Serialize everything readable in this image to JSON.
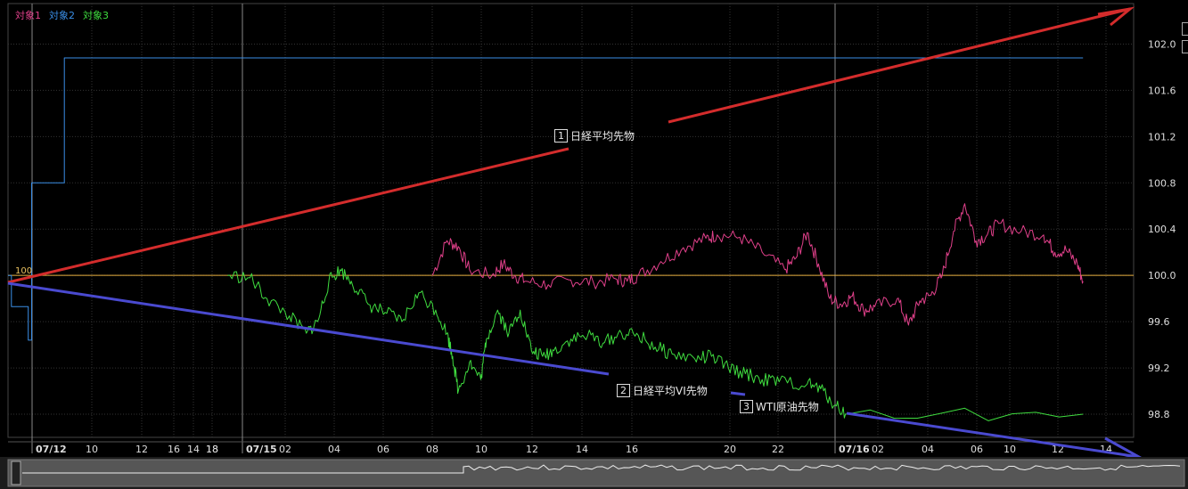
{
  "legend": [
    {
      "label": "対象1",
      "color": "#e0408a"
    },
    {
      "label": "対象2",
      "color": "#3a8ee6"
    },
    {
      "label": "対象3",
      "color": "#3fdc3f"
    }
  ],
  "baseline_label": "100",
  "annotations": [
    {
      "num": "1",
      "text": "日経平均先物"
    },
    {
      "num": "2",
      "text": "日経平均VI先物"
    },
    {
      "num": "3",
      "text": "WTI原油先物"
    }
  ],
  "chart_data": {
    "type": "line",
    "ylim": [
      98.6,
      102.35
    ],
    "y_ticks": [
      "98.8",
      "99.2",
      "99.6",
      "100.0",
      "100.4",
      "100.8",
      "101.2",
      "101.6",
      "102.0"
    ],
    "x_ticks": [
      "07/12",
      "10",
      "12",
      "14",
      "16",
      "18",
      "07/15",
      "02",
      "04",
      "06",
      "08",
      "10",
      "12",
      "14",
      "16",
      "18",
      "20",
      "22",
      "07/16",
      "02",
      "04",
      "06",
      "10",
      "12",
      "14"
    ],
    "baseline": 100,
    "grid": true,
    "series": [
      {
        "name": "対象1",
        "color": "#e0408a",
        "points": [
          [
            0.377,
            100.0
          ],
          [
            0.39,
            100.3
          ],
          [
            0.4,
            100.25
          ],
          [
            0.41,
            100.05
          ],
          [
            0.43,
            100.0
          ],
          [
            0.44,
            100.1
          ],
          [
            0.45,
            100.0
          ],
          [
            0.46,
            99.95
          ],
          [
            0.48,
            99.92
          ],
          [
            0.5,
            99.96
          ],
          [
            0.52,
            99.94
          ],
          [
            0.54,
            99.97
          ],
          [
            0.55,
            99.95
          ],
          [
            0.56,
            100.0
          ],
          [
            0.58,
            100.12
          ],
          [
            0.6,
            100.24
          ],
          [
            0.62,
            100.32
          ],
          [
            0.63,
            100.35
          ],
          [
            0.65,
            100.33
          ],
          [
            0.67,
            100.2
          ],
          [
            0.69,
            100.05
          ],
          [
            0.7,
            100.15
          ],
          [
            0.71,
            100.37
          ],
          [
            0.72,
            100.1
          ],
          [
            0.73,
            99.8
          ],
          [
            0.74,
            99.75
          ],
          [
            0.75,
            99.82
          ],
          [
            0.76,
            99.7
          ],
          [
            0.77,
            99.73
          ],
          [
            0.79,
            99.8
          ],
          [
            0.8,
            99.57
          ],
          [
            0.81,
            99.78
          ],
          [
            0.82,
            99.83
          ],
          [
            0.83,
            100.0
          ],
          [
            0.84,
            100.38
          ],
          [
            0.85,
            100.62
          ],
          [
            0.86,
            100.3
          ],
          [
            0.87,
            100.35
          ],
          [
            0.88,
            100.45
          ],
          [
            0.9,
            100.38
          ],
          [
            0.92,
            100.35
          ],
          [
            0.93,
            100.2
          ],
          [
            0.94,
            100.22
          ],
          [
            0.95,
            100.1
          ],
          [
            0.955,
            99.95
          ]
        ]
      },
      {
        "name": "対象2",
        "color": "#3a8ee6",
        "points": [
          [
            0.0,
            100.0
          ],
          [
            0.003,
            99.73
          ],
          [
            0.015,
            99.73
          ],
          [
            0.018,
            99.44
          ],
          [
            0.021,
            99.44
          ],
          [
            0.021,
            100.8
          ],
          [
            0.05,
            100.8
          ],
          [
            0.05,
            101.88
          ],
          [
            0.955,
            101.88
          ]
        ]
      },
      {
        "name": "対象3",
        "color": "#3fdc3f",
        "points": [
          [
            0.195,
            100.0
          ],
          [
            0.215,
            99.98
          ],
          [
            0.23,
            99.8
          ],
          [
            0.25,
            99.65
          ],
          [
            0.265,
            99.5
          ],
          [
            0.275,
            99.6
          ],
          [
            0.285,
            99.95
          ],
          [
            0.295,
            100.05
          ],
          [
            0.305,
            99.95
          ],
          [
            0.32,
            99.75
          ],
          [
            0.335,
            99.68
          ],
          [
            0.35,
            99.6
          ],
          [
            0.365,
            99.85
          ],
          [
            0.38,
            99.7
          ],
          [
            0.39,
            99.5
          ],
          [
            0.395,
            99.3
          ],
          [
            0.4,
            99.0
          ],
          [
            0.41,
            99.25
          ],
          [
            0.42,
            99.1
          ],
          [
            0.425,
            99.45
          ],
          [
            0.435,
            99.7
          ],
          [
            0.445,
            99.5
          ],
          [
            0.455,
            99.7
          ],
          [
            0.465,
            99.35
          ],
          [
            0.475,
            99.3
          ],
          [
            0.485,
            99.35
          ],
          [
            0.5,
            99.45
          ],
          [
            0.515,
            99.48
          ],
          [
            0.53,
            99.42
          ],
          [
            0.545,
            99.5
          ],
          [
            0.56,
            99.48
          ],
          [
            0.575,
            99.38
          ],
          [
            0.59,
            99.32
          ],
          [
            0.61,
            99.28
          ],
          [
            0.625,
            99.3
          ],
          [
            0.64,
            99.2
          ],
          [
            0.655,
            99.15
          ],
          [
            0.67,
            99.1
          ],
          [
            0.685,
            99.08
          ],
          [
            0.71,
            99.06
          ],
          [
            0.722,
            99.02
          ],
          [
            0.735,
            98.88
          ],
          [
            0.745,
            98.8
          ],
          [
            0.955,
            98.8
          ]
        ]
      }
    ]
  }
}
